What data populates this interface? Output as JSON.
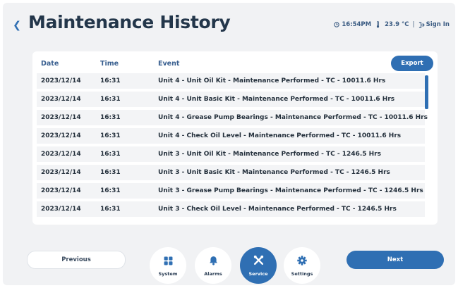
{
  "header": {
    "back_icon": "chevron-left-icon",
    "title": "Maintenance History",
    "time": "16:54PM",
    "temperature": "23.9 °C",
    "sign_in": "Sign In"
  },
  "table": {
    "columns": [
      "Date",
      "Time",
      "Event"
    ],
    "export_label": "Export",
    "rows": [
      {
        "date": "2023/12/14",
        "time": "16:31",
        "event": "Unit 4 - Unit Oil Kit - Maintenance Performed - TC - 10011.6 Hrs"
      },
      {
        "date": "2023/12/14",
        "time": "16:31",
        "event": "Unit 4 - Unit Basic Kit - Maintenance Performed - TC - 10011.6 Hrs"
      },
      {
        "date": "2023/12/14",
        "time": "16:31",
        "event": "Unit 4 - Grease Pump Bearings - Maintenance Performed - TC - 10011.6 Hrs"
      },
      {
        "date": "2023/12/14",
        "time": "16:31",
        "event": "Unit 4 - Check Oil Level - Maintenance Performed - TC - 10011.6 Hrs"
      },
      {
        "date": "2023/12/14",
        "time": "16:31",
        "event": "Unit 3 - Unit Oil Kit - Maintenance Performed - TC - 1246.5 Hrs"
      },
      {
        "date": "2023/12/14",
        "time": "16:31",
        "event": "Unit 3 - Unit Basic Kit - Maintenance Performed - TC - 1246.5 Hrs"
      },
      {
        "date": "2023/12/14",
        "time": "16:31",
        "event": "Unit 3 - Grease Pump Bearings - Maintenance Performed - TC - 1246.5 Hrs"
      },
      {
        "date": "2023/12/14",
        "time": "16:31",
        "event": "Unit 3 - Check Oil Level - Maintenance Performed - TC - 1246.5 Hrs"
      }
    ]
  },
  "nav": {
    "previous_label": "Previous",
    "next_label": "Next",
    "items": [
      {
        "label": "System",
        "icon": "grid-icon",
        "active": false
      },
      {
        "label": "Alarms",
        "icon": "bell-icon",
        "active": false
      },
      {
        "label": "Service",
        "icon": "tools-icon",
        "active": true
      },
      {
        "label": "Settings",
        "icon": "gear-icon",
        "active": false
      }
    ]
  },
  "colors": {
    "accent": "#2f6fb3",
    "title": "#23364a",
    "background": "#f1f2f4"
  }
}
